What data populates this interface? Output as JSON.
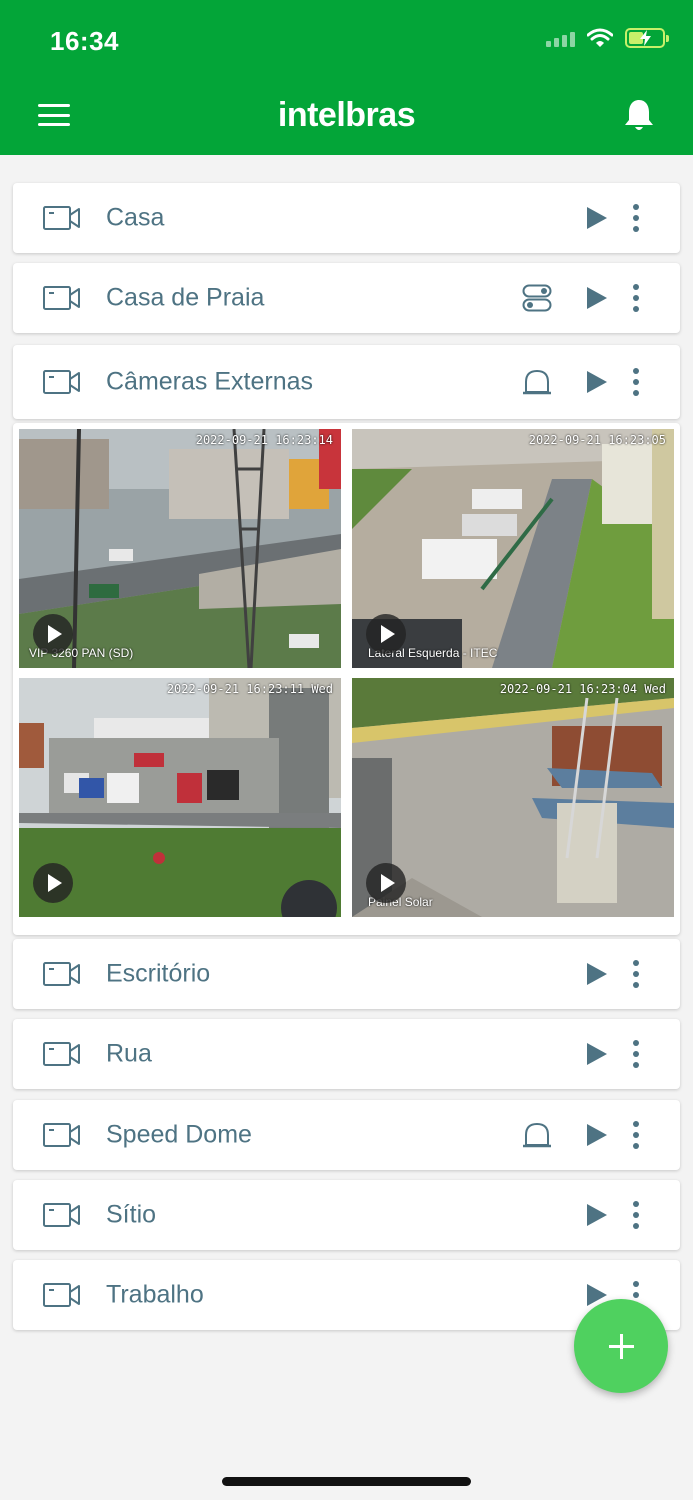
{
  "status_bar": {
    "time": "16:34"
  },
  "header": {
    "logo": "intelbras"
  },
  "groups": [
    {
      "name": "Casa"
    },
    {
      "name": "Casa de Praia"
    },
    {
      "name": "Câmeras Externas"
    },
    {
      "name": "Escritório"
    },
    {
      "name": "Rua"
    },
    {
      "name": "Speed Dome"
    },
    {
      "name": "Sítio"
    },
    {
      "name": "Trabalho"
    }
  ],
  "cameras": [
    {
      "timestamp": "2022-09-21 16:23:14",
      "caption": "VIP 3260 PAN (SD)"
    },
    {
      "timestamp": "2022-09-21 16:23:05",
      "caption": "Lateral Esquerda - ITEC"
    },
    {
      "timestamp": "2022-09-21 16:23:11 Wed",
      "caption": ""
    },
    {
      "timestamp": "2022-09-21 16:23:04 Wed",
      "caption": "Painel Solar"
    }
  ],
  "icons": {
    "menu": "menu-icon",
    "bell": "bell-icon",
    "camera": "camera-icon",
    "play": "play-icon",
    "more": "more-vertical-icon",
    "toggle": "toggle-icon",
    "alarm": "alarm-icon",
    "add": "plus-icon"
  },
  "colors": {
    "brand": "#03a538",
    "fab": "#4fd15f",
    "text": "#4e7383",
    "background": "#f3f3f3"
  }
}
